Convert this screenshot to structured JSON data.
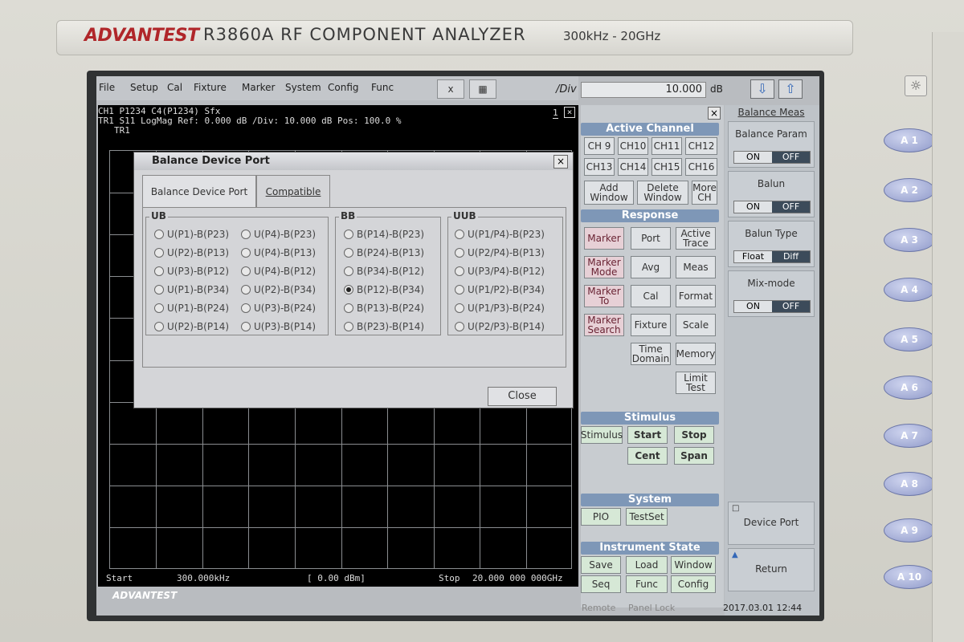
{
  "bezel": {
    "brand": "ADVANTEST",
    "model": "R3860A  RF COMPONENT  ANALYZER",
    "freq_range": "300kHz - 20GHz"
  },
  "menu": [
    "File",
    "Setup",
    "Cal",
    "Fixture",
    "Marker",
    "System",
    "Config",
    "Func"
  ],
  "toolbar": {
    "x_label": "x",
    "div_label": "/Div",
    "div_value": "10.000",
    "unit": "dB"
  },
  "trace": {
    "line1": "CH1   P1234   C4(P1234) Sfx",
    "line2": "TR1    S11    LogMag  Ref:  0.000 dB  /Div: 10.000 dB  Pos: 100.0 %",
    "line3": "TR1",
    "window_num": "1",
    "start_label": "Start",
    "start_val": "300.000kHz",
    "power": "[  0.00 dBm]",
    "stop_label": "Stop",
    "stop_val": "20.000 000 000GHz",
    "brand": "ADVANTEST"
  },
  "dialog": {
    "title": "Balance Device Port",
    "tabs": [
      "Balance Device Port",
      "Compatible"
    ],
    "groups": [
      {
        "label": "UB",
        "items": [
          "U(P1)-B(P23)",
          "U(P2)-B(P13)",
          "U(P3)-B(P12)",
          "U(P1)-B(P34)",
          "U(P1)-B(P24)",
          "U(P2)-B(P14)",
          "U(P4)-B(P23)",
          "U(P4)-B(P13)",
          "U(P4)-B(P12)",
          "U(P2)-B(P34)",
          "U(P3)-B(P24)",
          "U(P3)-B(P14)"
        ]
      },
      {
        "label": "BB",
        "items": [
          "B(P14)-B(P23)",
          "B(P24)-B(P13)",
          "B(P34)-B(P12)",
          "B(P12)-B(P34)",
          "B(P13)-B(P24)",
          "B(P23)-B(P14)"
        ]
      },
      {
        "label": "UUB",
        "items": [
          "U(P1/P4)-B(P23)",
          "U(P2/P4)-B(P13)",
          "U(P3/P4)-B(P12)",
          "U(P1/P2)-B(P34)",
          "U(P1/P3)-B(P24)",
          "U(P2/P3)-B(P14)"
        ]
      }
    ],
    "selected": "B(P12)-B(P34)",
    "close": "Close"
  },
  "panel": {
    "active_channel": "Active Channel",
    "channels": [
      "CH 9",
      "CH10",
      "CH11",
      "CH12",
      "CH13",
      "CH14",
      "CH15",
      "CH16"
    ],
    "add_window": "Add Window",
    "delete_window": "Delete Window",
    "more_ch": "More CH",
    "response": "Response",
    "marker": "Marker",
    "port": "Port",
    "active_trace": "Active Trace",
    "marker_mode": "Marker Mode",
    "avg": "Avg",
    "meas": "Meas",
    "marker_to": "Marker To",
    "cal": "Cal",
    "format": "Format",
    "marker_search": "Marker Search",
    "fixture": "Fixture",
    "scale": "Scale",
    "time_domain": "Time Domain",
    "memory": "Memory",
    "limit_test": "Limit Test",
    "stimulus": "Stimulus",
    "stimulus_btn": "Stimulus",
    "start": "Start",
    "stop": "Stop",
    "cent": "Cent",
    "span": "Span",
    "system": "System",
    "pio": "PIO",
    "testset": "TestSet",
    "instrument_state": "Instrument State",
    "save": "Save",
    "load": "Load",
    "window": "Window",
    "seq": "Seq",
    "func": "Func",
    "config": "Config"
  },
  "side": {
    "header": "Balance Meas",
    "balance_param": "Balance Param",
    "balun": "Balun",
    "balun_type": "Balun Type",
    "mix_mode": "Mix-mode",
    "on": "ON",
    "off": "OFF",
    "float": "Float",
    "diff": "Diff",
    "device_port": "Device Port",
    "return": "Return"
  },
  "status": {
    "remote": "Remote",
    "panel_lock": "Panel Lock",
    "datetime": "2017.03.01 12:44"
  },
  "softkeys": [
    "A 1",
    "A 2",
    "A 3",
    "A 4",
    "A 5",
    "A 6",
    "A 7",
    "A 8",
    "A 9",
    "A 10"
  ]
}
